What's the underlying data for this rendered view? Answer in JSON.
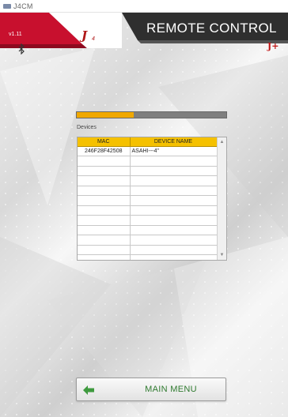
{
  "window": {
    "title": "J4CM"
  },
  "header": {
    "version": "v1.11",
    "logo_text": "J",
    "logo_sub": "4",
    "title": "REMOTE CONTROL",
    "brand_mark": "J+"
  },
  "progress": {
    "value": 0.38,
    "color": "#f0a800"
  },
  "devices": {
    "label": "Devices",
    "columns": [
      "MAC",
      "DEVICE NAME"
    ],
    "rows": [
      {
        "mac": "246F28F42508",
        "name": "ASAHI---4\""
      }
    ],
    "empty_rows": 12
  },
  "main_menu": {
    "label": "MAIN MENU"
  },
  "colors": {
    "accent_red": "#c8102e",
    "header_dark": "#2f2f2f",
    "menu_green": "#2f7a2f",
    "grid_header": "#f5c100"
  },
  "icons": {
    "bluetooth": "bluetooth-icon",
    "back": "arrow-left-icon"
  }
}
